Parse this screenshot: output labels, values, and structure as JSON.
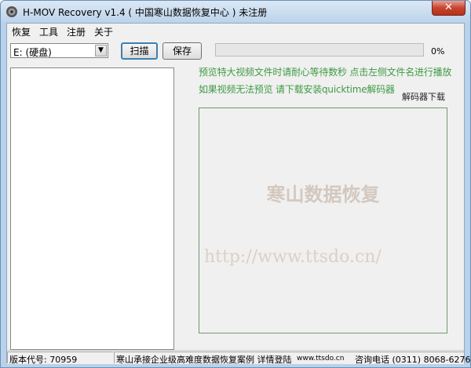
{
  "window": {
    "title": "H-MOV Recovery v1.4 ( 中国寒山数据恢复中心 ) 未注册",
    "close_label": "✕"
  },
  "menu": [
    "恢复",
    "工具",
    "注册",
    "关于"
  ],
  "toolbar": {
    "drive_value": "E: (硬盘)",
    "scan_label": "扫描",
    "save_label": "保存",
    "progress_percent": 0,
    "progress_text": "0%"
  },
  "hints": [
    "预览特大视频文件时请耐心等待数秒  点击左侧文件名进行播放",
    "如果视频无法预览 请下载安装quicktime解码器"
  ],
  "decoder_link": "解码器下载",
  "preview": {
    "watermark_title": "寒山数据恢复",
    "watermark_url": "http://www.ttsdo.cn/"
  },
  "status": {
    "version": "版本代号: 70959",
    "promo": "寒山承接企业级高难度数据恢复案例 详情登陆",
    "url": "www.ttsdo.cn",
    "contact": "咨询电话 (0311) 8068-6276"
  },
  "colors": {
    "hint_text": "#3f9a45",
    "progress_fill": "#3bb54a",
    "titlebar": "#bcd3ea"
  }
}
